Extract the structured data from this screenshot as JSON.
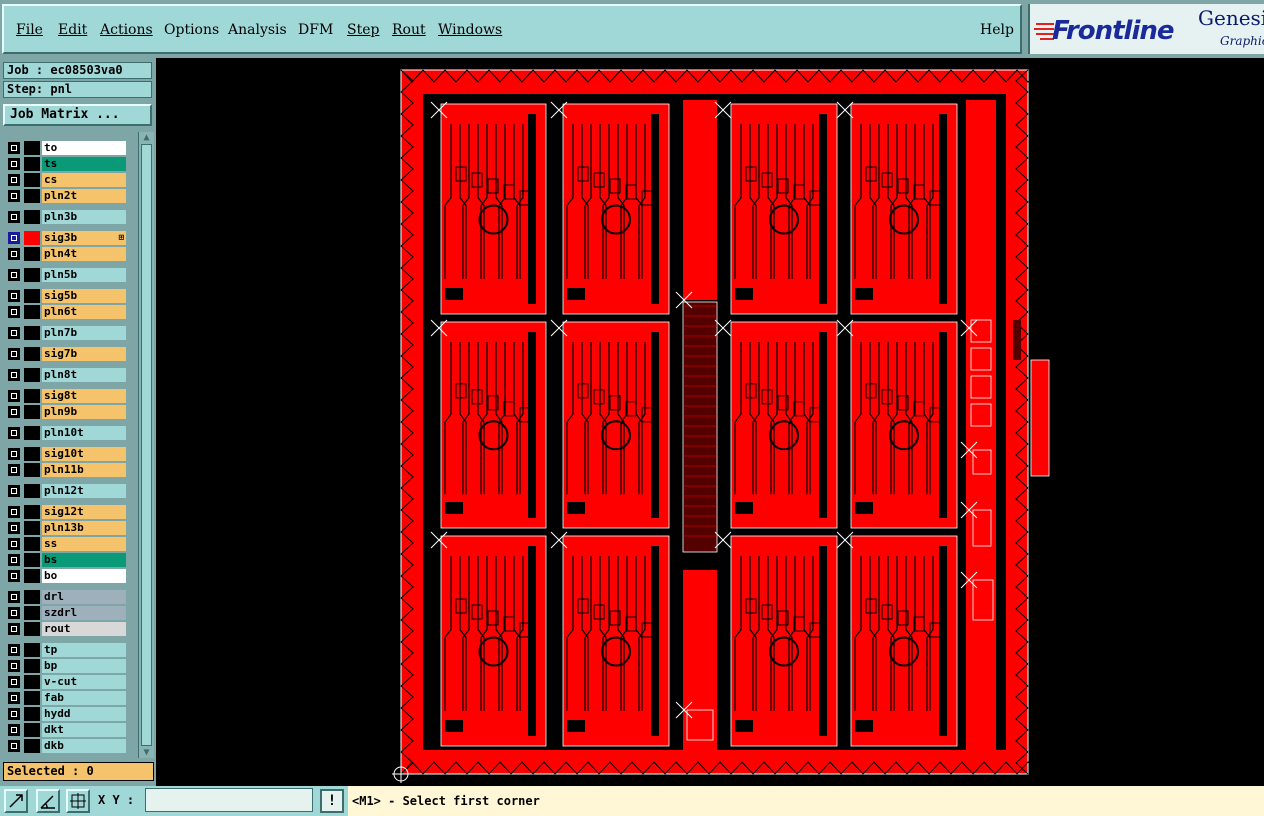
{
  "menu": {
    "items": [
      "File",
      "Edit",
      "Actions",
      "Options",
      "Analysis",
      "DFM",
      "Step",
      "Rout",
      "Windows"
    ],
    "help": "Help"
  },
  "logo": {
    "brand": "Frontline",
    "product": "Genesis",
    "tagline": "Graphics"
  },
  "job": {
    "job_label": "Job : ec08503va0",
    "step_label": "Step: pnl",
    "matrix_button": "Job Matrix ..."
  },
  "layers": [
    {
      "name": "to",
      "color": "#ffffff"
    },
    {
      "name": "ts",
      "color": "#0a9a78"
    },
    {
      "name": "cs",
      "color": "#f5c36b"
    },
    {
      "name": "pln2t",
      "color": "#f5c36b"
    },
    {
      "name": "pln3b",
      "color": "#a0d8d8"
    },
    {
      "name": "sig3b",
      "color": "#f5c36b",
      "active": true
    },
    {
      "name": "pln4t",
      "color": "#f5c36b"
    },
    {
      "name": "pln5b",
      "color": "#a0d8d8"
    },
    {
      "name": "sig5b",
      "color": "#f5c36b"
    },
    {
      "name": "pln6t",
      "color": "#f5c36b"
    },
    {
      "name": "pln7b",
      "color": "#a0d8d8"
    },
    {
      "name": "sig7b",
      "color": "#f5c36b"
    },
    {
      "name": "pln8t",
      "color": "#a0d8d8"
    },
    {
      "name": "sig8t",
      "color": "#f5c36b"
    },
    {
      "name": "pln9b",
      "color": "#f5c36b"
    },
    {
      "name": "pln10t",
      "color": "#a0d8d8"
    },
    {
      "name": "sig10t",
      "color": "#f5c36b"
    },
    {
      "name": "pln11b",
      "color": "#f5c36b"
    },
    {
      "name": "pln12t",
      "color": "#a0d8d8"
    },
    {
      "name": "sig12t",
      "color": "#f5c36b"
    },
    {
      "name": "pln13b",
      "color": "#f5c36b"
    },
    {
      "name": "ss",
      "color": "#f5c36b"
    },
    {
      "name": "bs",
      "color": "#0a9a78"
    },
    {
      "name": "bo",
      "color": "#ffffff"
    },
    {
      "name": "drl",
      "color": "#9fb0bd"
    },
    {
      "name": "szdrl",
      "color": "#9fb0bd"
    },
    {
      "name": "rout",
      "color": "#d8d8d8"
    },
    {
      "name": "tp",
      "color": "#a0d8d8"
    },
    {
      "name": "bp",
      "color": "#a0d8d8"
    },
    {
      "name": "v-cut",
      "color": "#a0d8d8"
    },
    {
      "name": "fab",
      "color": "#a0d8d8"
    },
    {
      "name": "hydd",
      "color": "#a0d8d8"
    },
    {
      "name": "dkt",
      "color": "#a0d8d8"
    },
    {
      "name": "dkb",
      "color": "#a0d8d8"
    }
  ],
  "selected_label": "Selected : 0",
  "bottom": {
    "xy_label": "X Y :",
    "xy_value": "",
    "warn_symbol": "!",
    "prompt": "<M1> - Select first corner"
  },
  "colors": {
    "panel_bg": "#7fa6a6",
    "panel_face": "#a0d8d8",
    "board_red": "#ff0000",
    "board_dark": "#000000",
    "selected_bg": "#f5c36b"
  }
}
